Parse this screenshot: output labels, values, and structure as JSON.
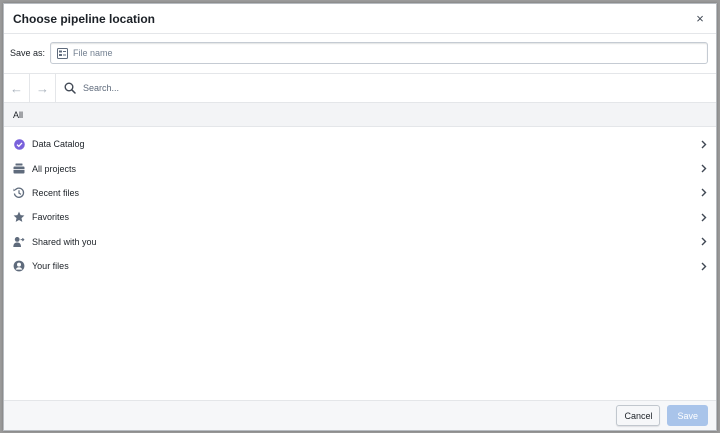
{
  "dialog": {
    "title": "Choose pipeline location",
    "close_glyph": "×"
  },
  "save_as": {
    "label": "Save as:",
    "placeholder": "File name",
    "value": ""
  },
  "nav": {
    "back_glyph": "←",
    "forward_glyph": "→",
    "search_placeholder": "Search..."
  },
  "breadcrumb": {
    "current": "All"
  },
  "locations": [
    {
      "label": "Data Catalog",
      "icon": "data-catalog-icon"
    },
    {
      "label": "All projects",
      "icon": "projects-icon"
    },
    {
      "label": "Recent files",
      "icon": "history-icon"
    },
    {
      "label": "Favorites",
      "icon": "star-icon"
    },
    {
      "label": "Shared with you",
      "icon": "shared-icon"
    },
    {
      "label": "Your files",
      "icon": "user-icon"
    }
  ],
  "footer": {
    "cancel_label": "Cancel",
    "save_label": "Save"
  },
  "colors": {
    "catalog_purple": "#7961db",
    "icon_gray": "#5f6b7c",
    "save_disabled": "#a9c4ea"
  }
}
